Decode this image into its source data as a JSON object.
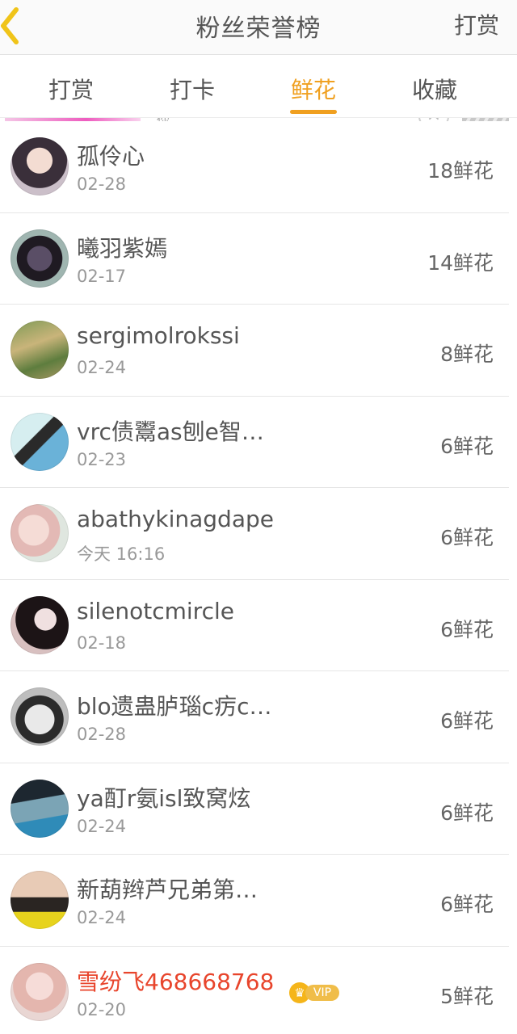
{
  "header": {
    "title": "粉丝荣誉榜",
    "action_label": "打赏",
    "back_icon": "chevron-left-icon",
    "accent_color": "#f0c419"
  },
  "tabs": [
    {
      "label": "打赏",
      "active": false
    },
    {
      "label": "打卡",
      "active": false
    },
    {
      "label": "鲜花",
      "active": true
    },
    {
      "label": "收藏",
      "active": false
    }
  ],
  "tab_active_color": "#f0a020",
  "ad": {
    "text": "你",
    "close_glyph": "×"
  },
  "fans": [
    {
      "name": "孤伶心",
      "date": "02-28",
      "count": "18鲜花",
      "vip": false
    },
    {
      "name": "曦羽紫嫣",
      "date": "02-17",
      "count": "14鲜花",
      "vip": false
    },
    {
      "name": "sergimolrokssi",
      "date": "02-24",
      "count": "8鲜花",
      "vip": false
    },
    {
      "name": "vrc债鬻as刨e智…",
      "date": "02-23",
      "count": "6鲜花",
      "vip": false
    },
    {
      "name": "abathykinagdape",
      "date": "今天 16:16",
      "count": "6鲜花",
      "vip": false
    },
    {
      "name": "silenotcmircle",
      "date": "02-18",
      "count": "6鲜花",
      "vip": false
    },
    {
      "name": "blo遗蛊胪瑙c疠c…",
      "date": "02-28",
      "count": "6鲜花",
      "vip": false
    },
    {
      "name": "ya酊r氨isl致窝炫",
      "date": "02-24",
      "count": "6鲜花",
      "vip": false
    },
    {
      "name": "新葫辫芦兄弟第…",
      "date": "02-24",
      "count": "6鲜花",
      "vip": false
    },
    {
      "name": "雪纷飞468668768",
      "date": "02-20",
      "count": "5鲜花",
      "vip": true,
      "vip_label": "VIP"
    }
  ]
}
